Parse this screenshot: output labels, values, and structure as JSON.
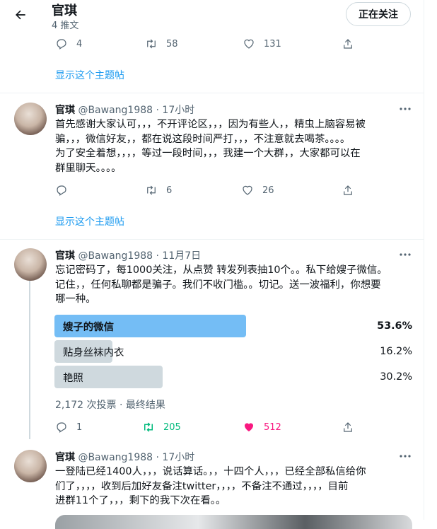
{
  "header": {
    "title": "官琪",
    "subtitle": "4 推文",
    "follow_label": "正在关注"
  },
  "top_actions": {
    "reply": "4",
    "retweet": "58",
    "like": "131"
  },
  "show_thread_1": "显示这个主题帖",
  "tweet1": {
    "name": "官琪",
    "meta": "@Bawang1988 · 17小时",
    "lines": [
      "首先感谢大家认可，，，不开评论区，，，因为有些人，，精虫上脑容易被",
      "骗，，，微信好友，，都在说这段时间严打，，，不注意就去喝茶。。。。",
      "为了安全着想，，，，等过一段时间，，，我建一个大群，，大家都可以在",
      "群里聊天。。。。"
    ],
    "actions": {
      "reply": "",
      "retweet": "6",
      "like": "26"
    }
  },
  "show_thread_2": "显示这个主题帖",
  "tweet2": {
    "name": "官琪",
    "meta": "@Bawang1988 · 11月7日",
    "lines": [
      "忘记密码了，每1000关注，从点赞 转发列表抽10个。。私下给嫂子微信。",
      "记住，，任何私聊都是骗子。我们不收门槛。。切记。送一波福利，你想要",
      "哪一种。"
    ],
    "poll": {
      "options": [
        {
          "label": "嫂子的微信",
          "percent": "53.6%",
          "share": 0.536,
          "winner": true
        },
        {
          "label": "贴身丝袜内衣",
          "percent": "16.2%",
          "share": 0.162,
          "winner": false
        },
        {
          "label": "艳照",
          "percent": "30.2%",
          "share": 0.302,
          "winner": false
        }
      ],
      "summary": "2,172 次投票 · 最终结果"
    },
    "actions": {
      "reply": "1",
      "retweet": "205",
      "like": "512"
    },
    "colors": {
      "retweet_active": "#00ba7c",
      "like_active": "#f91880",
      "poll_winner": "#74bdf5",
      "poll_other": "#cfd9de"
    }
  },
  "tweet3": {
    "name": "官琪",
    "meta": "@Bawang1988 · 17小时",
    "lines": [
      "一登陆已经1400人，，，说话算话。，，十四个人，，，已经全部私信给你",
      "们了，，，，收到后加好友备注twitter，，，，不备注不通过，，，，目前",
      "进群11个了，，，剩下的我下次在看。。"
    ]
  }
}
